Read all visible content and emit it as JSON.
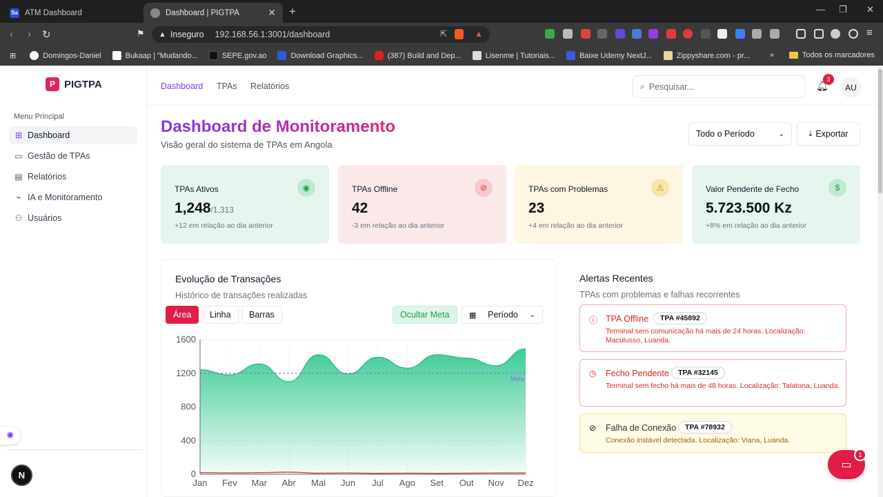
{
  "browser": {
    "tabs": [
      {
        "label": "ATM Dashboard",
        "icon": "Sa"
      },
      {
        "label": "Dashboard | PIGTPA"
      }
    ],
    "address": {
      "security_label": "Inseguro",
      "url": "192.168.56.1:3001/dashboard"
    },
    "bookmarks": [
      {
        "label": "Domingos-Daniel",
        "color": "#ffffff"
      },
      {
        "label": "Bukaap | \"Mudando...",
        "color": "#ffffff"
      },
      {
        "label": "SEPE.gov.ao",
        "color": "#111111"
      },
      {
        "label": "Download Graphics...",
        "color": "#2b5cd6"
      },
      {
        "label": "(387) Build and Dep...",
        "color": "#e02020"
      },
      {
        "label": "Lisenme | Tutoriais...",
        "color": "#dddddd"
      },
      {
        "label": "Baixe Udemy NextJ...",
        "color": "#3b5bdb"
      },
      {
        "label": "Zippyshare.com - pr...",
        "color": "#e8d7a0"
      }
    ],
    "all_bookmarks_label": "Todos os marcadores"
  },
  "app": {
    "brand": {
      "logo": "P",
      "name": "PIGTPA"
    },
    "sidebar": {
      "section_label": "Menu Principal",
      "items": [
        {
          "label": "Dashboard",
          "icon": "grid-icon",
          "glyph": "⊞"
        },
        {
          "label": "Gestão de TPAs",
          "icon": "terminal-icon",
          "glyph": "▭"
        },
        {
          "label": "Relatórios",
          "icon": "document-icon",
          "glyph": "▤"
        },
        {
          "label": "IA e Monitoramento",
          "icon": "activity-icon",
          "glyph": "⌁"
        },
        {
          "label": "Usuários",
          "icon": "users-icon",
          "glyph": "⚇"
        }
      ],
      "next_badge": "N"
    },
    "topnav": {
      "links": [
        "Dashboard",
        "TPAs",
        "Relatórios"
      ],
      "search_placeholder": "Pesquisar...",
      "notifications_count": "3",
      "avatar_initials": "AU"
    },
    "header": {
      "title": "Dashboard de Monitoramento",
      "subtitle": "Visão geral do sistema de TPAs em Angola",
      "period_value": "Todo o Período",
      "export_label": "Exportar"
    },
    "cards": [
      {
        "title": "TPAs Ativos",
        "value": "1,248",
        "suffix": "/1,313",
        "note": "+12 em relação ao dia anterior",
        "icon": "wifi-icon",
        "glyph": "◉"
      },
      {
        "title": "TPAs Offline",
        "value": "42",
        "suffix": "",
        "note": "-3 em relação ao dia anterior",
        "icon": "wifi-off-icon",
        "glyph": "⊘"
      },
      {
        "title": "TPAs com Problemas",
        "value": "23",
        "suffix": "",
        "note": "+4 em relação ao dia anterior",
        "icon": "warning-icon",
        "glyph": "⚠"
      },
      {
        "title": "Valor Pendente de Fecho",
        "value": "5.723.500 Kz",
        "suffix": "",
        "note": "+8% em relação ao dia anterior",
        "icon": "dollar-icon",
        "glyph": "$"
      }
    ],
    "chart_panel": {
      "title": "Evolução de Transações",
      "subtitle": "Histórico de transações realizadas",
      "type_buttons": [
        "Área",
        "Linha",
        "Barras"
      ],
      "hide_target_label": "Ocultar Meta",
      "period_label": "Período"
    },
    "alerts_panel": {
      "title": "Alertas Recentes",
      "subtitle": "TPAs com problemas e falhas recorrentes",
      "alerts": [
        {
          "title": "TPA Offline",
          "tag": "TPA #45892",
          "desc": "Terminal sem comunicação há mais de 24 horas. Localização: Maculusso, Luanda.",
          "severity": "red"
        },
        {
          "title": "Fecho Pendente",
          "tag": "TPA #32145",
          "desc": "Terminal sem fecho há mais de 48 horas. Localização: Talatona, Luanda.",
          "severity": "red"
        },
        {
          "title": "Falha de Conexão",
          "tag": "TPA #78932",
          "desc": "Conexão instável detectada. Localização: Viana, Luanda.",
          "severity": "yellow"
        }
      ]
    },
    "chat_badge": "1",
    "colors": {
      "accent": "#7c3aed",
      "brand": "#e11d48",
      "area": "#34c98f"
    }
  },
  "chart_data": {
    "type": "area",
    "categories": [
      "Jan",
      "Fev",
      "Mar",
      "Abr",
      "Mai",
      "Jun",
      "Jul",
      "Ago",
      "Set",
      "Out",
      "Nov",
      "Dez"
    ],
    "series": [
      {
        "values": [
          1240,
          1180,
          1310,
          1100,
          1420,
          1190,
          1390,
          1260,
          1420,
          1380,
          1290,
          1490
        ]
      },
      {
        "values": [
          20,
          15,
          18,
          25,
          12,
          14,
          10,
          12,
          10,
          12,
          14,
          15
        ]
      }
    ],
    "target": {
      "value": 1200,
      "label": "Meta"
    },
    "yticks": [
      0,
      400,
      800,
      1200,
      1600
    ],
    "ylim": [
      0,
      1600
    ],
    "grid": true
  }
}
